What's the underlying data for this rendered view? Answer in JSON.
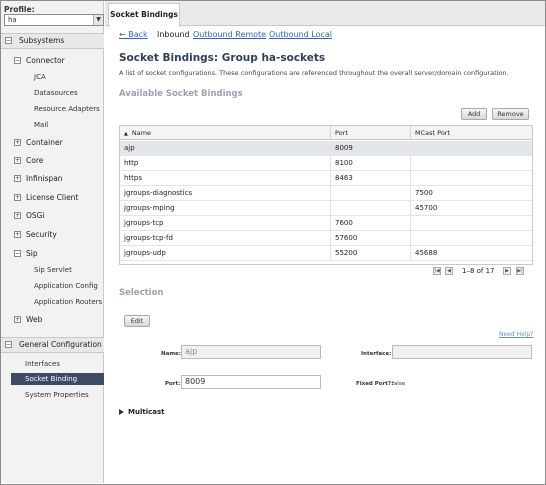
{
  "sidebar": {
    "profile_label": "Profile:",
    "profile_value": "ha",
    "subsystems_label": "Subsystems",
    "items": [
      {
        "label": "Connector",
        "expanded": true,
        "children": [
          "JCA",
          "Datasources",
          "Resource Adapters",
          "Mail"
        ]
      },
      {
        "label": "Container"
      },
      {
        "label": "Core"
      },
      {
        "label": "Infinispan"
      },
      {
        "label": "License Client"
      },
      {
        "label": "OSGi"
      },
      {
        "label": "Security"
      },
      {
        "label": "Sip",
        "expanded": true,
        "children": [
          "Sip Servlet",
          "Application Config",
          "Application Routers"
        ]
      },
      {
        "label": "Web"
      }
    ],
    "general_label": "General Configuration",
    "general_items": [
      "Interfaces",
      "Socket Binding",
      "System Properties"
    ],
    "general_selected": "Socket Binding"
  },
  "tab": {
    "label": "Socket Bindings"
  },
  "subnav": {
    "back": "← Back",
    "inbound": "Inbound",
    "outbound_remote": "Outbound Remote",
    "outbound_local": "Outbound Local"
  },
  "page": {
    "title": "Socket Bindings: Group ha-sockets",
    "description": "A list of socket configurations. These configurations are referenced throughout the overall server/domain configuration.",
    "available_heading": "Available Socket Bindings",
    "add_label": "Add",
    "remove_label": "Remove"
  },
  "table": {
    "columns": [
      "Name",
      "Port",
      "MCast Port"
    ],
    "rows": [
      {
        "name": "ajp",
        "port": "8009",
        "mcast": ""
      },
      {
        "name": "http",
        "port": "8100",
        "mcast": ""
      },
      {
        "name": "https",
        "port": "8463",
        "mcast": ""
      },
      {
        "name": "jgroups-diagnostics",
        "port": "",
        "mcast": "7500"
      },
      {
        "name": "jgroups-mping",
        "port": "",
        "mcast": "45700"
      },
      {
        "name": "jgroups-tcp",
        "port": "7600",
        "mcast": ""
      },
      {
        "name": "jgroups-tcp-fd",
        "port": "57600",
        "mcast": ""
      },
      {
        "name": "jgroups-udp",
        "port": "55200",
        "mcast": "45688"
      }
    ],
    "selected_row": 0
  },
  "pager": {
    "text": "1–8 of 17"
  },
  "selection": {
    "heading": "Selection",
    "edit_label": "Edit",
    "help_link": "Need Help?",
    "name_label": "Name:",
    "name_value": "ajp",
    "interface_label": "Interface:",
    "interface_value": "",
    "port_label": "Port:",
    "port_value": "8009",
    "fixed_port_label": "Fixed Port?:",
    "fixed_port_value": "false",
    "multicast_label": "Multicast"
  }
}
